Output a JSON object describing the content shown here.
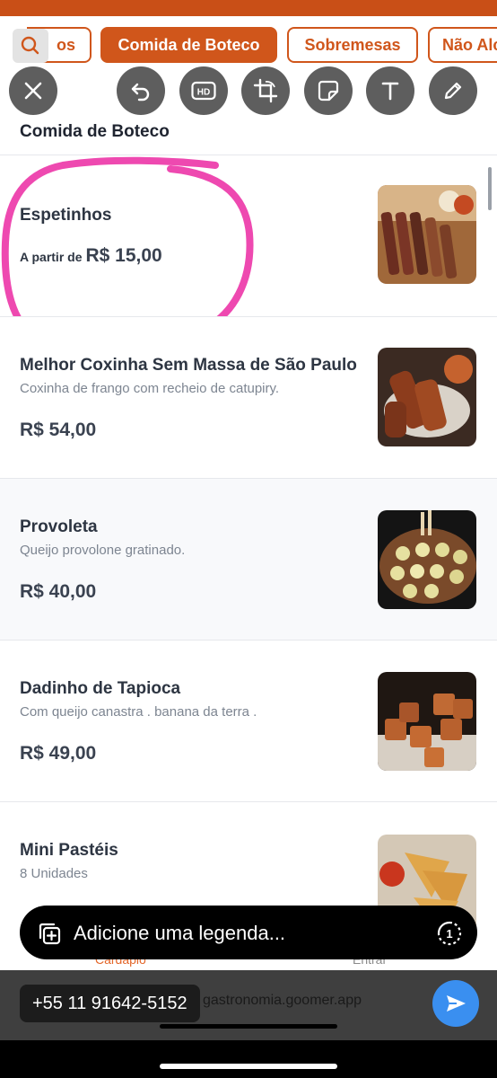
{
  "category_tabs": [
    {
      "label": "Pratos",
      "visible_text": "os"
    },
    {
      "label": "Comida de Boteco",
      "active": true
    },
    {
      "label": "Sobremesas"
    },
    {
      "label": "Não Alc",
      "visible_text": "Não Alc"
    }
  ],
  "section_title": "Comida de Boteco",
  "items": [
    {
      "name": "Espetinhos",
      "description": "",
      "price_prefix": "A partir de",
      "price": "R$ 15,00",
      "image_icon": "skewers-photo"
    },
    {
      "name": "Melhor Coxinha Sem Massa de São Paulo",
      "description": "Coxinha de frango com recheio de catupiry.",
      "price": "R$ 54,00",
      "image_icon": "coxinha-photo"
    },
    {
      "name": "Provoleta",
      "description": "Queijo provolone gratinado.",
      "price": "R$ 40,00",
      "image_icon": "provoleta-photo"
    },
    {
      "name": "Dadinho de Tapioca",
      "description": "Com queijo canastra . banana da terra .",
      "price": "R$ 49,00",
      "image_icon": "tapioca-cubes-photo"
    },
    {
      "name": "Mini Pastéis",
      "description": "8 Unidades",
      "price": "",
      "image_icon": "pasteis-photo"
    }
  ],
  "editor_tools": [
    "close-icon",
    "undo-icon",
    "hd-icon",
    "crop-icon",
    "sticker-icon",
    "text-icon",
    "draw-icon"
  ],
  "caption": {
    "placeholder": "Adicione uma legenda..."
  },
  "bottom_nav": {
    "menu_label": "Cardápio",
    "login_label": "Entrar"
  },
  "recipient": {
    "phone": "+55 11 91642-5152",
    "url_fragment": "gastronomia.goomer.app"
  },
  "colors": {
    "brand_orange": "#d0561b",
    "annotation_pink": "#ee49b0",
    "send_blue": "#3a8ff0"
  }
}
